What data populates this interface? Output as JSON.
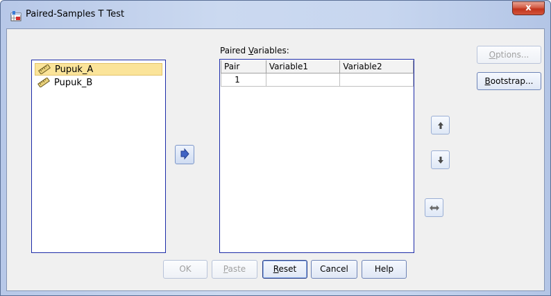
{
  "window": {
    "title": "Paired-Samples T Test",
    "close_glyph": "x"
  },
  "source_list": {
    "items": [
      {
        "label": "Pupuk_A",
        "selected": true
      },
      {
        "label": "Pupuk_B",
        "selected": false
      }
    ]
  },
  "paired": {
    "label_pre": "Paired ",
    "label_hot": "V",
    "label_post": "ariables:",
    "columns": [
      "Pair",
      "Variable1",
      "Variable2"
    ],
    "rows": [
      {
        "pair": "1",
        "variable1": "",
        "variable2": ""
      }
    ]
  },
  "buttons": {
    "options": {
      "hot": "O",
      "rest": "ptions..."
    },
    "bootstrap": {
      "hot": "B",
      "rest": "ootstrap..."
    },
    "ok": "OK",
    "paste": {
      "hot": "P",
      "rest": "aste"
    },
    "reset": {
      "hot": "R",
      "rest": "eset"
    },
    "cancel": "Cancel",
    "help": "Help"
  },
  "icons": {
    "move": "move-right-arrow-icon",
    "up": "up-arrow-icon",
    "down": "down-arrow-icon",
    "swap": "swap-horizontal-icon"
  },
  "colors": {
    "accent": "#1c2ba8",
    "selection": "#fbe49a",
    "close": "#c2331c"
  }
}
